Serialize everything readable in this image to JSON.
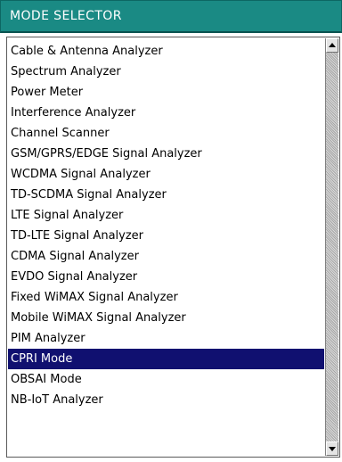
{
  "title": "MODE SELECTOR",
  "colors": {
    "title_bar": "#1a8a84",
    "selected_bg": "#101070",
    "selected_text": "#ffffff"
  },
  "list": {
    "items": [
      {
        "label": "Cable & Antenna Analyzer",
        "selected": false
      },
      {
        "label": "Spectrum Analyzer",
        "selected": false
      },
      {
        "label": "Power Meter",
        "selected": false
      },
      {
        "label": "Interference Analyzer",
        "selected": false
      },
      {
        "label": "Channel Scanner",
        "selected": false
      },
      {
        "label": "GSM/GPRS/EDGE Signal Analyzer",
        "selected": false
      },
      {
        "label": "WCDMA Signal Analyzer",
        "selected": false
      },
      {
        "label": "TD-SCDMA Signal Analyzer",
        "selected": false
      },
      {
        "label": "LTE Signal Analyzer",
        "selected": false
      },
      {
        "label": "TD-LTE Signal Analyzer",
        "selected": false
      },
      {
        "label": "CDMA Signal Analyzer",
        "selected": false
      },
      {
        "label": "EVDO Signal Analyzer",
        "selected": false
      },
      {
        "label": "Fixed WiMAX Signal Analyzer",
        "selected": false
      },
      {
        "label": "Mobile WiMAX Signal Analyzer",
        "selected": false
      },
      {
        "label": "PIM Analyzer",
        "selected": false
      },
      {
        "label": "CPRI Mode",
        "selected": true
      },
      {
        "label": "OBSAI Mode",
        "selected": false
      },
      {
        "label": "NB-IoT Analyzer",
        "selected": false
      }
    ]
  },
  "scrollbar": {
    "up_icon": "arrow-up-icon",
    "down_icon": "arrow-down-icon"
  }
}
